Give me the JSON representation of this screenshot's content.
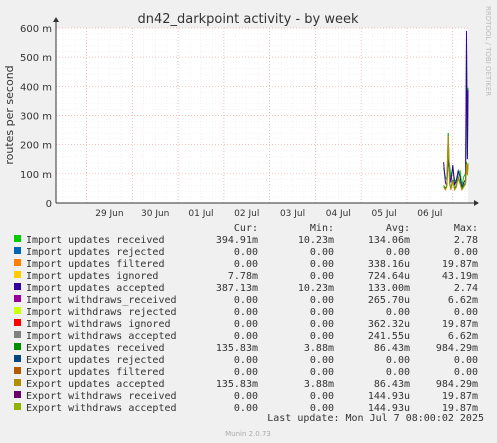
{
  "chart_data": {
    "type": "line",
    "title": "dn42_darkpoint activity - by week",
    "ylabel": "routes per second",
    "side_label": "RRDTOOL / TOBI OETIKER",
    "footer": "Munin 2.0.73",
    "ylim": [
      0,
      600
    ],
    "yticks": [
      "0",
      "100 m",
      "200 m",
      "300 m",
      "400 m",
      "500 m",
      "600 m"
    ],
    "ytick_values": [
      0,
      100,
      200,
      300,
      400,
      500,
      600
    ],
    "xticks": [
      "29 Jun",
      "30 Jun",
      "01 Jul",
      "02 Jul",
      "03 Jul",
      "04 Jul",
      "05 Jul",
      "06 Jul"
    ],
    "xrange": [
      "2025-06-28 08:00",
      "2025-07-07 08:00"
    ],
    "grid": true,
    "headers": [
      "Cur:",
      "Min:",
      "Avg:",
      "Max:"
    ],
    "series": [
      {
        "name": "Import updates received",
        "color": "#00cc00",
        "cur": "394.91m",
        "min": "10.23m",
        "avg": "134.06m",
        "max": "2.78",
        "values": [
          [
            6.8,
            120
          ],
          [
            6.84,
            90
          ],
          [
            6.87,
            80
          ],
          [
            6.9,
            160
          ],
          [
            6.93,
            130
          ],
          [
            6.96,
            90
          ],
          [
            7.0,
            120
          ],
          [
            7.04,
            80
          ],
          [
            7.08,
            70
          ],
          [
            7.12,
            100
          ],
          [
            7.16,
            110
          ],
          [
            7.2,
            60
          ],
          [
            7.24,
            90
          ],
          [
            7.28,
            100
          ],
          [
            7.3,
            550
          ],
          [
            7.31,
            400
          ],
          [
            7.32,
            160
          ],
          [
            7.333,
            395
          ]
        ]
      },
      {
        "name": "Import updates rejected",
        "color": "#0066b3",
        "cur": "0.00",
        "min": "0.00",
        "avg": "0.00",
        "max": "0.00"
      },
      {
        "name": "Import updates filtered",
        "color": "#ff8000",
        "cur": "0.00",
        "min": "0.00",
        "avg": "338.16u",
        "max": "19.87m"
      },
      {
        "name": "Import updates ignored",
        "color": "#ffcc00",
        "cur": "7.78m",
        "min": "0.00",
        "avg": "724.64u",
        "max": "43.19m"
      },
      {
        "name": "Import updates accepted",
        "color": "#330099",
        "cur": "387.13m",
        "min": "10.23m",
        "avg": "133.00m",
        "max": "2.74",
        "values": [
          [
            6.8,
            140
          ],
          [
            6.84,
            70
          ],
          [
            6.87,
            60
          ],
          [
            6.9,
            150
          ],
          [
            6.93,
            100
          ],
          [
            6.96,
            70
          ],
          [
            7.0,
            130
          ],
          [
            7.04,
            60
          ],
          [
            7.08,
            80
          ],
          [
            7.12,
            110
          ],
          [
            7.16,
            90
          ],
          [
            7.2,
            50
          ],
          [
            7.24,
            70
          ],
          [
            7.28,
            80
          ],
          [
            7.3,
            590
          ],
          [
            7.31,
            380
          ],
          [
            7.32,
            150
          ],
          [
            7.333,
            387
          ]
        ]
      },
      {
        "name": "Import withdraws_received",
        "color": "#990099",
        "cur": "0.00",
        "min": "0.00",
        "avg": "265.70u",
        "max": "6.62m"
      },
      {
        "name": "Import withdraws rejected",
        "color": "#ccff00",
        "cur": "0.00",
        "min": "0.00",
        "avg": "0.00",
        "max": "0.00"
      },
      {
        "name": "Import withdraws ignored",
        "color": "#ff0000",
        "cur": "0.00",
        "min": "0.00",
        "avg": "362.32u",
        "max": "19.87m"
      },
      {
        "name": "Import withdraws accepted",
        "color": "#808080",
        "cur": "0.00",
        "min": "0.00",
        "avg": "241.55u",
        "max": "6.62m"
      },
      {
        "name": "Export updates received",
        "color": "#008f00",
        "cur": "135.83m",
        "min": "3.88m",
        "avg": "86.43m",
        "max": "984.29m",
        "values": [
          [
            6.8,
            60
          ],
          [
            6.84,
            50
          ],
          [
            6.87,
            60
          ],
          [
            6.9,
            240
          ],
          [
            6.93,
            70
          ],
          [
            6.96,
            50
          ],
          [
            7.0,
            80
          ],
          [
            7.04,
            50
          ],
          [
            7.08,
            60
          ],
          [
            7.12,
            90
          ],
          [
            7.16,
            70
          ],
          [
            7.2,
            50
          ],
          [
            7.24,
            60
          ],
          [
            7.28,
            70
          ],
          [
            7.3,
            140
          ],
          [
            7.31,
            120
          ],
          [
            7.32,
            100
          ],
          [
            7.333,
            136
          ]
        ]
      },
      {
        "name": "Export updates rejected",
        "color": "#00487d",
        "cur": "0.00",
        "min": "0.00",
        "avg": "0.00",
        "max": "0.00"
      },
      {
        "name": "Export updates filtered",
        "color": "#b35a00",
        "cur": "0.00",
        "min": "0.00",
        "avg": "0.00",
        "max": "0.00"
      },
      {
        "name": "Export updates accepted",
        "color": "#b38f00",
        "cur": "135.83m",
        "min": "3.88m",
        "avg": "86.43m",
        "max": "984.29m",
        "values": [
          [
            6.8,
            55
          ],
          [
            6.84,
            45
          ],
          [
            6.87,
            55
          ],
          [
            6.9,
            230
          ],
          [
            6.93,
            65
          ],
          [
            6.96,
            45
          ],
          [
            7.0,
            75
          ],
          [
            7.04,
            45
          ],
          [
            7.08,
            55
          ],
          [
            7.12,
            85
          ],
          [
            7.16,
            65
          ],
          [
            7.2,
            45
          ],
          [
            7.24,
            55
          ],
          [
            7.28,
            65
          ],
          [
            7.3,
            135
          ],
          [
            7.31,
            115
          ],
          [
            7.32,
            95
          ],
          [
            7.333,
            136
          ]
        ]
      },
      {
        "name": "Export withdraws received",
        "color": "#6b006b",
        "cur": "0.00",
        "min": "0.00",
        "avg": "144.93u",
        "max": "19.87m"
      },
      {
        "name": "Export withdraws accepted",
        "color": "#8fb300",
        "cur": "0.00",
        "min": "0.00",
        "avg": "144.93u",
        "max": "19.87m"
      }
    ],
    "last_update": "Last update: Mon Jul  7 08:00:02 2025"
  }
}
